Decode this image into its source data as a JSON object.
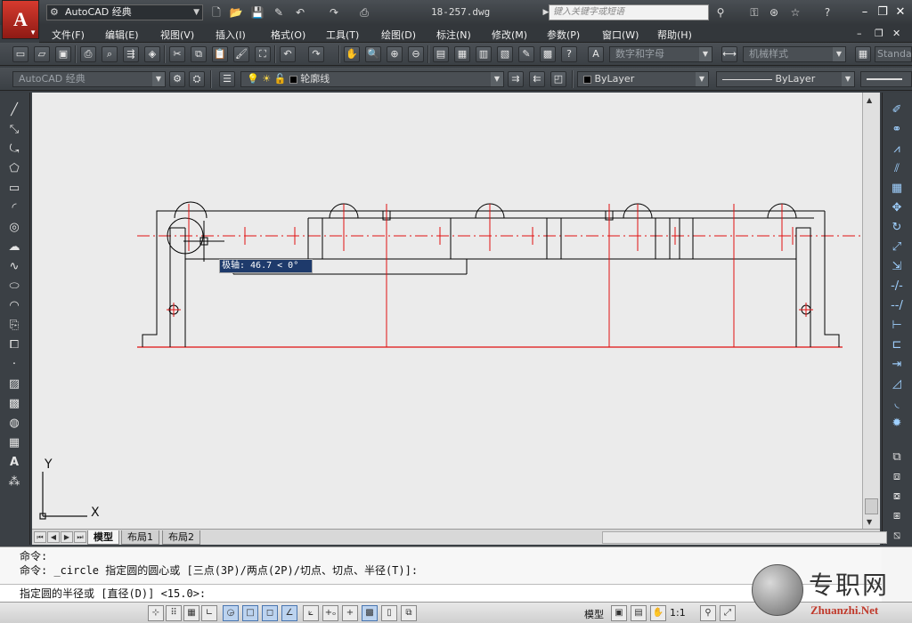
{
  "app": {
    "logo": "A",
    "workspace": "AutoCAD 经典",
    "document_title": "18-257.dwg",
    "search_placeholder": "键入关键字或短语"
  },
  "menu": [
    "文件(F)",
    "编辑(E)",
    "视图(V)",
    "插入(I)",
    "格式(O)",
    "工具(T)",
    "绘图(D)",
    "标注(N)",
    "修改(M)",
    "参数(P)",
    "窗口(W)",
    "帮助(H)"
  ],
  "toolbar1": {
    "text_style": "数字和字母",
    "dim_style": "机械样式",
    "table_style": "Standa"
  },
  "toolbar2": {
    "workspace": "AutoCAD 经典",
    "layer": "轮廓线",
    "color": "ByLayer",
    "linetype": "ByLayer"
  },
  "tooltip": {
    "polar": "极轴: 46.7 < 0°"
  },
  "ucs": {
    "x_label": "X",
    "y_label": "Y"
  },
  "layout_tabs": [
    "模型",
    "布局1",
    "布局2"
  ],
  "command": {
    "history": [
      "命令:",
      "命令: _circle 指定圆的圆心或 [三点(3P)/两点(2P)/切点、切点、半径(T)]:"
    ],
    "prompt": "指定圆的半径或 [直径(D)] <15.0>:"
  },
  "status": {
    "model_label": "模型",
    "scale": "1:1"
  },
  "watermark": {
    "title": "专职网",
    "url": "Zhuanzhi.Net"
  },
  "colors": {
    "drawing_bg": "#ebebeb",
    "outline": "#000000",
    "centerline": "#e01010",
    "tooltip_bg": "#1e3a6b"
  }
}
